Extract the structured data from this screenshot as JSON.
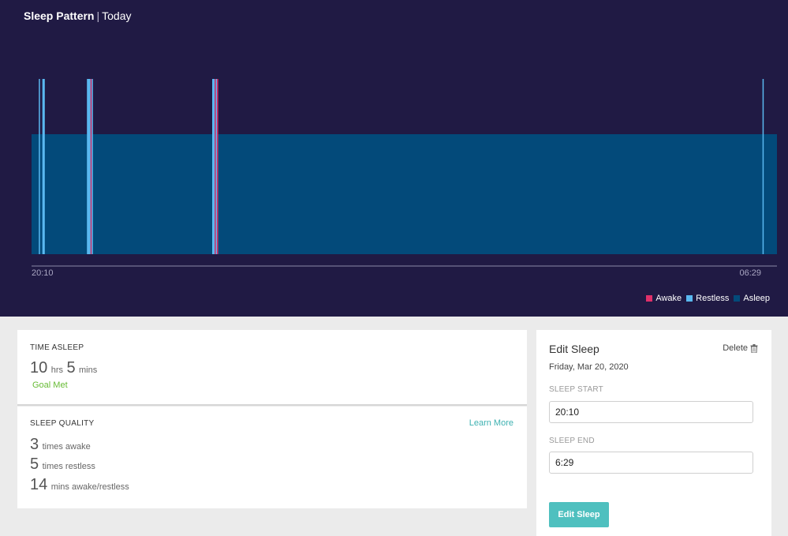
{
  "header": {
    "title": "Sleep Pattern",
    "separator": "|",
    "subtitle": "Today"
  },
  "colors": {
    "panel_bg": "#201a44",
    "awake": "#e0306a",
    "restless": "#5ab8f0",
    "asleep": "#034a7a",
    "accent": "#4fc0bf",
    "goal": "#66bb33"
  },
  "chart_data": {
    "type": "area",
    "start_label": "20:10",
    "end_label": "06:29",
    "start_minute": 0,
    "end_minute": 619,
    "levels": [
      "Asleep",
      "Restless",
      "Awake"
    ],
    "segments": [
      {
        "state": "Asleep",
        "start": 0,
        "end": 619
      },
      {
        "state": "Restless",
        "start": 6,
        "end": 7
      },
      {
        "state": "Restless",
        "start": 9,
        "end": 11
      },
      {
        "state": "Restless",
        "start": 46,
        "end": 49
      },
      {
        "state": "Awake",
        "start": 49,
        "end": 50
      },
      {
        "state": "Restless",
        "start": 50,
        "end": 51
      },
      {
        "state": "Restless",
        "start": 150,
        "end": 152
      },
      {
        "state": "Awake",
        "start": 152,
        "end": 153
      },
      {
        "state": "Restless",
        "start": 153,
        "end": 154
      },
      {
        "state": "Awake",
        "start": 154,
        "end": 155
      },
      {
        "state": "Restless",
        "start": 607,
        "end": 608
      }
    ],
    "legend": [
      "Awake",
      "Restless",
      "Asleep"
    ],
    "legend_position": "bottom-right"
  },
  "legend": {
    "awake": "Awake",
    "restless": "Restless",
    "asleep": "Asleep"
  },
  "time_asleep": {
    "label": "TIME ASLEEP",
    "hours": "10",
    "hours_unit": "hrs",
    "minutes": "5",
    "minutes_unit": "mins",
    "goal_status": "Goal Met"
  },
  "sleep_quality": {
    "label": "SLEEP QUALITY",
    "learn_more": "Learn More",
    "awake_count": "3",
    "awake_text": "times awake",
    "restless_count": "5",
    "restless_text": "times restless",
    "minutes_count": "14",
    "minutes_text": "mins awake/restless"
  },
  "edit_sleep": {
    "title": "Edit Sleep",
    "delete_label": "Delete",
    "trash_icon": "trash-icon",
    "date": "Friday, Mar 20, 2020",
    "start_label": "SLEEP START",
    "start_value": "20:10",
    "end_label": "SLEEP END",
    "end_value": "6:29",
    "button_label": "Edit Sleep"
  }
}
